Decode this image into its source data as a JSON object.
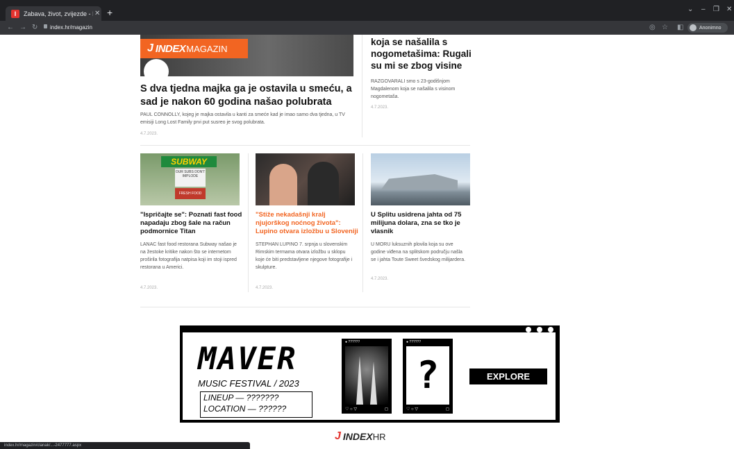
{
  "browser": {
    "tab_title": "Zabava, život, zvijezde - Index.hr",
    "tab_favicon": "I",
    "url": "index.hr/magazin",
    "profile_label": "Anonimno"
  },
  "hero": {
    "badge_j": "J",
    "badge_index": "INDEX",
    "badge_magazin": "MAGAZIN",
    "title": "S dva tjedna majka ga je ostavila u smeću, a sad je nakon 60 godina našao polubrata",
    "desc": "PAUL CONNOLLY, kojeg je majka ostavila u kanti za smeće kad je imao samo dva tjedna, u TV emisiji Long Lost Family prvi put susreo je svog polubrata.",
    "date": "4.7.2023."
  },
  "side_article": {
    "title": "koja se našalila s nogometašima: Rugali su mi se zbog visine",
    "desc": "RAZGOVARALI smo s 23-godišnjom Magdalenom koja se našalila s visinom nogometaša.",
    "date": "4.7.2023."
  },
  "articles": [
    {
      "title": "\"Ispričajte se\": Poznati fast food napadaju zbog šale na račun podmornice Titan",
      "desc": "LANAC fast food restorana Subway našao je na žestoke kritike nakon što se internetom proširila fotografija natpisa koji im stoji ispred restorana u Americi.",
      "date": "4.7.2023.",
      "sign": "SUBWAY",
      "board": "OUR SUBS DON'T IMPLODE",
      "red": "FRESH FOOD"
    },
    {
      "title": "\"Stiže nekadašnji kralj njujorškog noćnog života\": Lupino otvara izložbu u Sloveniji",
      "desc": "STEPHAN LUPINO 7. srpnja u slovenskim Rimskim termama otvara izložbu u sklopu koje će biti predstavljene njegove fotografije i skulpture.",
      "date": "4.7.2023."
    },
    {
      "title": "U Splitu usidrena jahta od 75 milijuna dolara, zna se tko je vlasnik",
      "desc": "U MORU luksuznih plovila koja su ove godine viđena na splitskom području našla se i jahta Toute Sweet švedskog milijardera.",
      "date": "4.7.2023."
    }
  ],
  "ad": {
    "brand": "MAVER",
    "festival": "MUSIC FESTIVAL / 2023",
    "lineup": "LINEUP — ???????",
    "location": "LOCATION — ??????",
    "phone_bar": "● ??????",
    "phone_bar_dots": "···",
    "phone_foot": "♡ ○ ▽",
    "phone_save": "◻",
    "qmark": "?",
    "cta": "EXPLORE"
  },
  "footer": {
    "j": "J",
    "index": "INDEX",
    "hr": "HR"
  },
  "status_url": "index.hr/magazin/clanak/...-2477777.aspx"
}
